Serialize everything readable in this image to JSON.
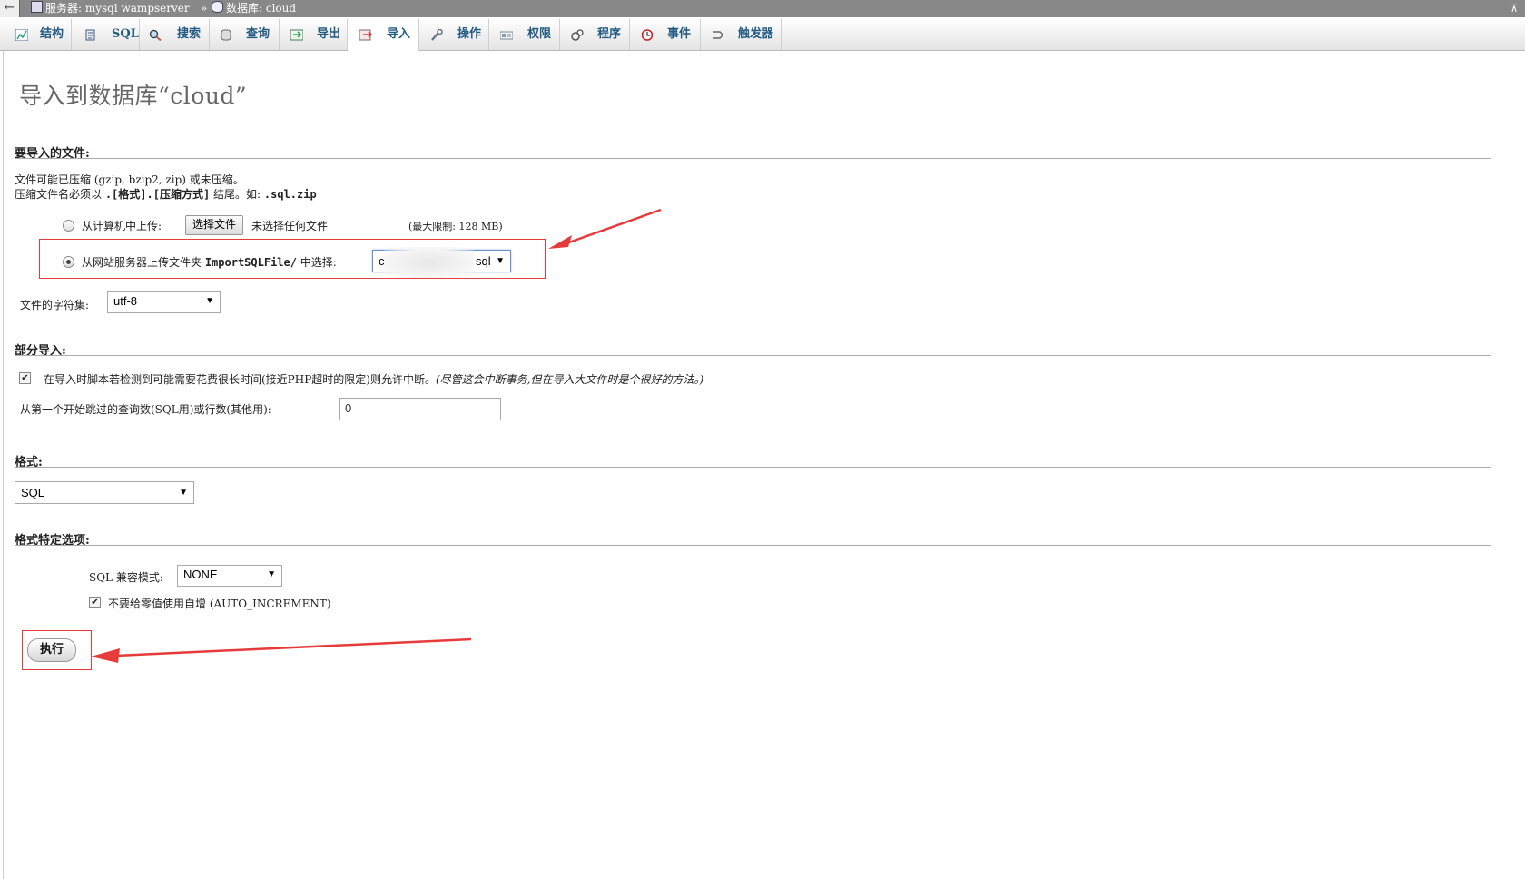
{
  "breadcrumb": {
    "back": "←",
    "server_label": "服务器: mysql wampserver",
    "separator": "»",
    "database_label": "数据库: cloud",
    "collapse": "⊼"
  },
  "tabs": [
    {
      "label": "结构",
      "icon": "structure-icon"
    },
    {
      "label": "SQL",
      "icon": "sql-icon"
    },
    {
      "label": "搜索",
      "icon": "search-icon"
    },
    {
      "label": "查询",
      "icon": "query-icon"
    },
    {
      "label": "导出",
      "icon": "export-icon"
    },
    {
      "label": "导入",
      "icon": "import-icon",
      "active": true
    },
    {
      "label": "操作",
      "icon": "wrench-icon"
    },
    {
      "label": "权限",
      "icon": "privileges-icon"
    },
    {
      "label": "程序",
      "icon": "routines-icon"
    },
    {
      "label": "事件",
      "icon": "events-icon"
    },
    {
      "label": "触发器",
      "icon": "triggers-icon"
    }
  ],
  "page_title": "导入到数据库“cloud”",
  "file_section": {
    "heading": "要导入的文件:",
    "note_line1": "文件可能已压缩 (gzip, bzip2, zip) 或未压缩。",
    "note_line2_prefix": "压缩文件名必须以 ",
    "note_line2_format": ".[格式].[压缩方式]",
    "note_line2_mid": " 结尾。如: ",
    "note_line2_example": ".sql.zip",
    "upload_local_label": "从计算机中上传:",
    "choose_file_button": "选择文件",
    "no_file_text": "未选择任何文件",
    "max_limit": "(最大限制: 128 MB)",
    "upload_server_prefix": "从网站服务器上传文件夹 ",
    "upload_server_folder": "ImportSQLFile/",
    "upload_server_suffix": " 中选择:",
    "server_file_value": "c",
    "server_file_suffix": "sql",
    "charset_label": "文件的字符集:",
    "charset_value": "utf-8"
  },
  "partial_section": {
    "heading": "部分导入:",
    "allow_interrupt_text": "在导入时脚本若检测到可能需要花费很长时间(接近PHP超时的限定)则允许中断。",
    "allow_interrupt_hint": "(尽管这会中断事务,但在导入大文件时是个很好的方法。)",
    "skip_label": "从第一个开始跳过的查询数(SQL用)或行数(其他用):",
    "skip_value": "0"
  },
  "format_section": {
    "heading": "格式:",
    "format_value": "SQL"
  },
  "format_options_section": {
    "heading": "格式特定选项:",
    "compat_label": "SQL 兼容模式:",
    "compat_value": "NONE",
    "no_auto_value_text": "不要给零值使用自增 (AUTO_INCREMENT)"
  },
  "go_button": "执行",
  "colors": {
    "annotation_red": "#e63b3b",
    "tab_text": "#235a81"
  }
}
